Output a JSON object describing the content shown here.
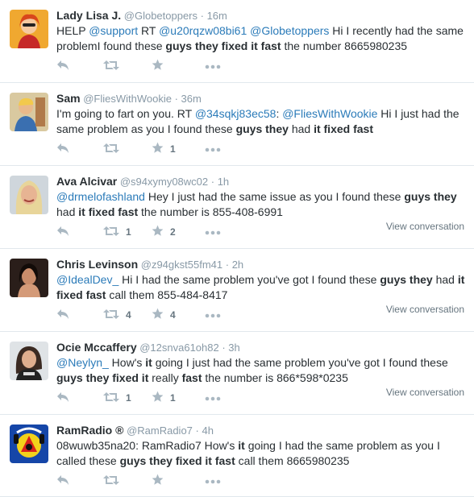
{
  "tweets": [
    {
      "name": "Lady Lisa J.",
      "handle": "@Globetoppers",
      "time": "16m",
      "text": [
        {
          "t": "HELP ",
          "k": "plain"
        },
        {
          "t": "@support",
          "k": "mention"
        },
        {
          "t": " RT ",
          "k": "plain"
        },
        {
          "t": "@u20rqzw08bi61",
          "k": "mention"
        },
        {
          "t": " ",
          "k": "plain"
        },
        {
          "t": "@Globetoppers",
          "k": "mention"
        },
        {
          "t": " Hi I recently had the same problemI found these ",
          "k": "plain"
        },
        {
          "t": "guys they fixed it fast",
          "k": "bold"
        },
        {
          "t": " the number  8665980235",
          "k": "plain"
        }
      ],
      "retweets": "",
      "favorites": "",
      "conversation": ""
    },
    {
      "name": "Sam",
      "handle": "@FliesWithWookie",
      "time": "36m",
      "text": [
        {
          "t": "I'm going to fart on you. RT ",
          "k": "plain"
        },
        {
          "t": "@34sqkj83ec58",
          "k": "mention"
        },
        {
          "t": ": ",
          "k": "plain"
        },
        {
          "t": "@FliesWithWookie",
          "k": "mention"
        },
        {
          "t": " Hi I just had the same problem as you I found these ",
          "k": "plain"
        },
        {
          "t": "guys they",
          "k": "bold"
        },
        {
          "t": " had ",
          "k": "plain"
        },
        {
          "t": "it fixed fast",
          "k": "bold"
        }
      ],
      "retweets": "",
      "favorites": "1",
      "conversation": ""
    },
    {
      "name": "Ava Alcivar",
      "handle": "@s94xymy08wc02",
      "time": "1h",
      "text": [
        {
          "t": "@drmelofashland",
          "k": "mention"
        },
        {
          "t": " Hey I just had the same issue as you I found these ",
          "k": "plain"
        },
        {
          "t": "guys they",
          "k": "bold"
        },
        {
          "t": " had ",
          "k": "plain"
        },
        {
          "t": "it fixed fast",
          "k": "bold"
        },
        {
          "t": " the number is 855-408-6991",
          "k": "plain"
        }
      ],
      "retweets": "1",
      "favorites": "2",
      "conversation": "View conversation"
    },
    {
      "name": "Chris Levinson",
      "handle": "@z94gkst55fm41",
      "time": "2h",
      "text": [
        {
          "t": "@IdealDev_",
          "k": "mention"
        },
        {
          "t": "  Hi I had the same problem you've got I found these ",
          "k": "plain"
        },
        {
          "t": "guys they",
          "k": "bold"
        },
        {
          "t": " had ",
          "k": "plain"
        },
        {
          "t": "it fixed fast",
          "k": "bold"
        },
        {
          "t": " call them 855-484-8417",
          "k": "plain"
        }
      ],
      "retweets": "4",
      "favorites": "4",
      "conversation": "View conversation"
    },
    {
      "name": "Ocie Mccaffery",
      "handle": "@12snva61oh82",
      "time": "3h",
      "text": [
        {
          "t": "@Neylyn_",
          "k": "mention"
        },
        {
          "t": "  How's ",
          "k": "plain"
        },
        {
          "t": "it",
          "k": "bold"
        },
        {
          "t": " going I just had the same problem you've got I found these ",
          "k": "plain"
        },
        {
          "t": "guys they fixed it",
          "k": "bold"
        },
        {
          "t": " really ",
          "k": "plain"
        },
        {
          "t": "fast",
          "k": "bold"
        },
        {
          "t": " the number is 866*598*0235",
          "k": "plain"
        }
      ],
      "retweets": "1",
      "favorites": "1",
      "conversation": "View conversation"
    },
    {
      "name": "RamRadio ®",
      "handle": "@RamRadio7",
      "time": "4h",
      "text": [
        {
          "t": "08wuwb35na20: RamRadio7 How's ",
          "k": "plain"
        },
        {
          "t": "it",
          "k": "bold"
        },
        {
          "t": " going I had the same problem as you I called these ",
          "k": "plain"
        },
        {
          "t": "guys they fixed it fast",
          "k": "bold"
        },
        {
          "t": " call them 8665980235",
          "k": "plain"
        }
      ],
      "retweets": "",
      "favorites": "",
      "conversation": ""
    }
  ],
  "icons": {
    "reply": "reply-icon",
    "retweet": "retweet-icon",
    "favorite": "star-icon",
    "more": "more-dots-icon"
  },
  "colors": {
    "name": "#292f33",
    "muted": "#8899a6",
    "mention": "#2b7bb9",
    "icon": "#aab8c2",
    "border": "#e1e8ed"
  },
  "separator": "·"
}
